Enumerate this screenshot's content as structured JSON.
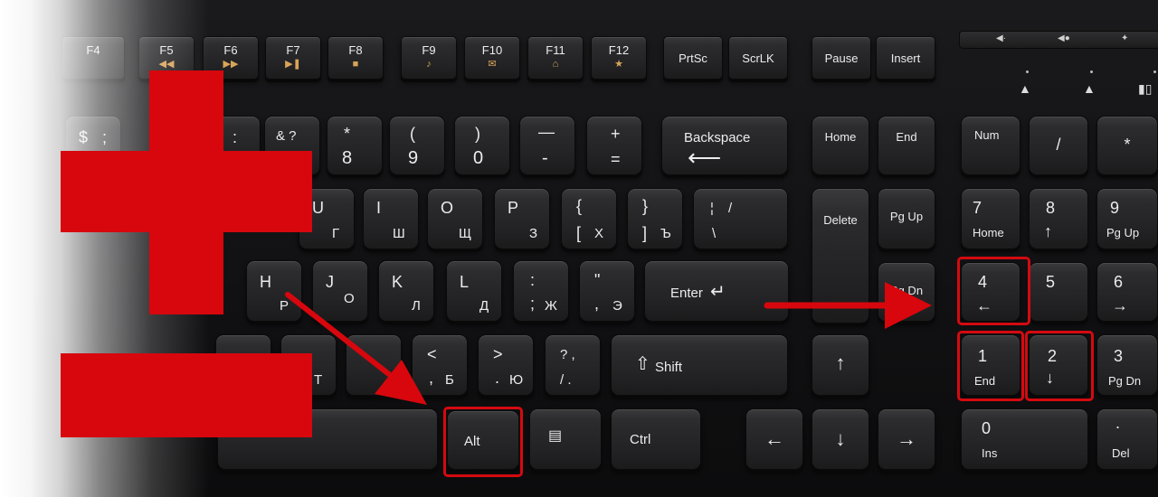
{
  "fkeys": {
    "f4": "F4",
    "f5": "F5",
    "f6": "F6",
    "f7": "F7",
    "f8": "F8",
    "f9": "F9",
    "f10": "F10",
    "f11": "F11",
    "f12": "F12",
    "prtsc": "PrtSc",
    "scrlk": "ScrLK",
    "pause": "Pause",
    "insert": "Insert"
  },
  "keys": {
    "row2": {
      "dollar": "$",
      "dollar_alt": ";",
      "colon": ":",
      "amp": "& ?",
      "k8_top": "*",
      "k8": "8",
      "k9_top": "(",
      "k9": "9",
      "k0_top": ")",
      "k0": "0",
      "minus_top": "—",
      "minus": "-",
      "plus_top": "+",
      "plus": "=",
      "backspace": "Backspace",
      "backspace_arrow": "⟵"
    },
    "row3": {
      "u": "U",
      "u_cyr": "Г",
      "i": "I",
      "i_cyr": "Ш",
      "o": "O",
      "o_cyr": "Щ",
      "p": "P",
      "p_cyr": "З",
      "lbrace": "{",
      "lbracket": "[",
      "x_cyr": "Х",
      "rbrace": "}",
      "rbracket": "]",
      "hard_cyr": "Ъ",
      "pipe": "¦",
      "slash": "/",
      "backslash": "\\"
    },
    "row4": {
      "h": "H",
      "h_cyr": "Р",
      "j": "J",
      "j_cyr": "О",
      "k": "K",
      "k_cyr": "Л",
      "l": "L",
      "l_cyr": "Д",
      "semicolon_top": ":",
      "semicolon": ";",
      "zh_cyr": "Ж",
      "quote_top": "\"",
      "quote": ",",
      "e_cyr": "Э",
      "enter": "Enter"
    },
    "row5": {
      "comma_top": "<",
      "comma": ",",
      "b_cyr": "Б",
      "period_top": ">",
      "period": ".",
      "yu_cyr": "Ю",
      "question_top": "? ,",
      "question": "/ .",
      "shift": "Shift"
    },
    "row6": {
      "alt": "Alt",
      "ctrl": "Ctrl"
    },
    "nav": {
      "home": "Home",
      "end": "End",
      "delete": "Delete",
      "pgup": "Pg Up",
      "pgdn": "Pg Dn",
      "up": "↑",
      "left": "←",
      "down": "↓",
      "right": "→"
    },
    "numpad": {
      "num": "Num",
      "divide": "/",
      "multiply": "*",
      "n7": "7",
      "n7_sub": "Home",
      "n8": "8",
      "n8_sub": "↑",
      "n9": "9",
      "n9_sub": "Pg Up",
      "n4": "4",
      "n4_sub": "←",
      "n5": "5",
      "n6": "6",
      "n6_sub": "→",
      "n1": "1",
      "n1_sub": "End",
      "n2": "2",
      "n2_sub": "↓",
      "n3": "3",
      "n3_sub": "Pg Dn",
      "n0": "0",
      "n0_sub": "Ins",
      "ndot": ".",
      "ndot_sub": "Del"
    }
  },
  "icons": {
    "f5": "f5-media-icon",
    "f6": "f6-media-icon",
    "f7": "play-pause-icon",
    "f8": "stop-icon",
    "f9": "music-note-icon",
    "f10": "mail-icon",
    "f11": "home-icon",
    "f12": "favorites-icon",
    "indicators": [
      "num-lock-indicator-icon",
      "caps-lock-indicator-icon",
      "battery-indicator-icon"
    ]
  },
  "colors": {
    "highlight": "#d40a10",
    "keycap": "#262628",
    "label": "#ececec",
    "fkey_icon": "#d9a45a"
  }
}
